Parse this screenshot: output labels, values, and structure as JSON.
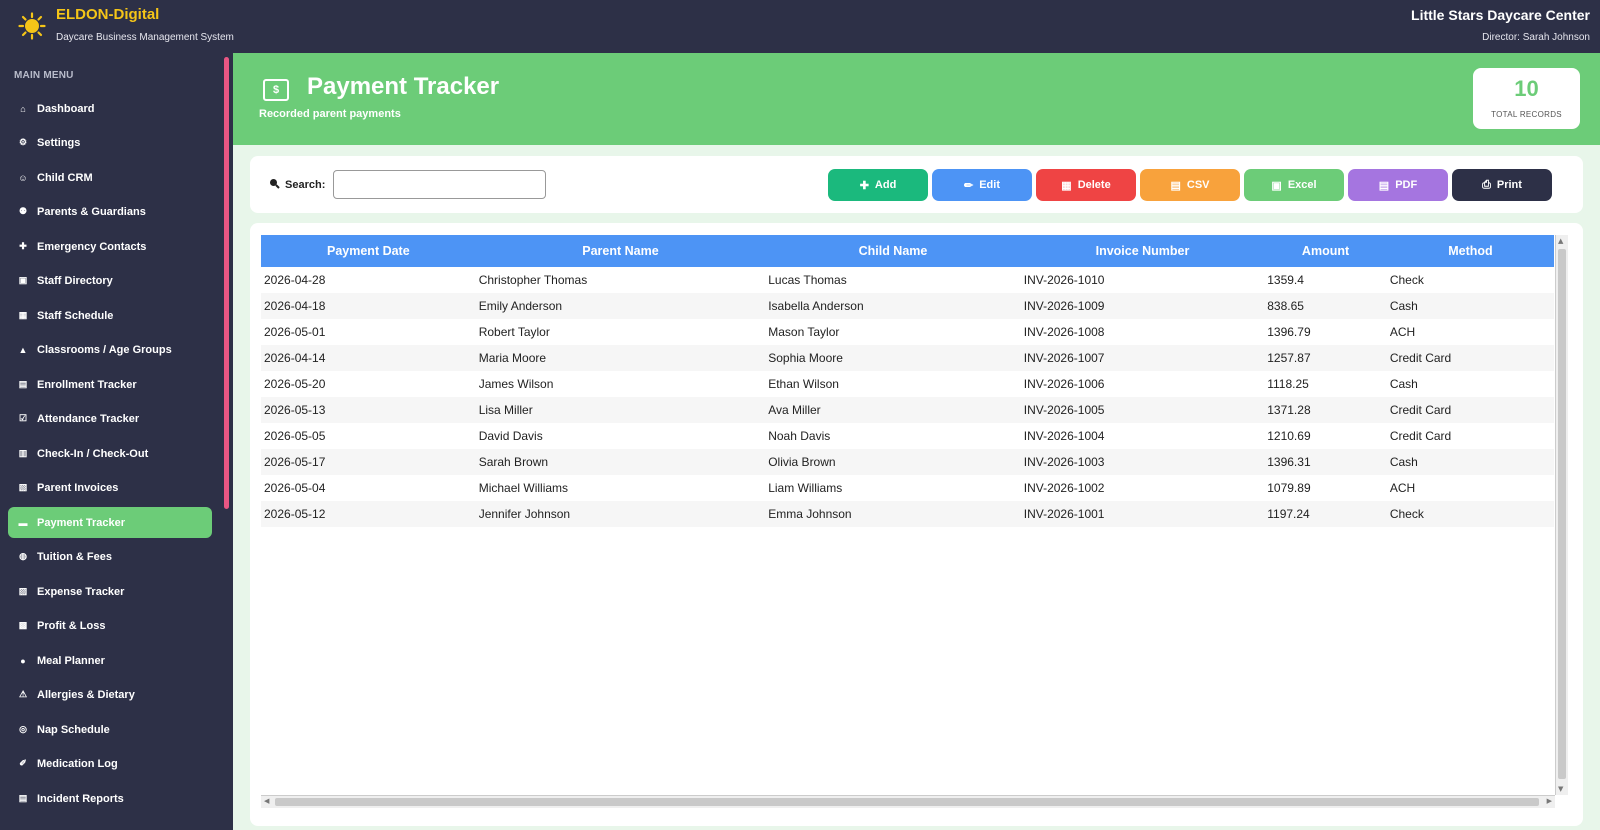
{
  "header": {
    "brand_name": "ELDON-Digital",
    "brand_subtitle": "Daycare Business Management System",
    "center_name": "Little Stars Daycare Center",
    "director": "Director: Sarah Johnson",
    "brand_color": "#f5c518"
  },
  "sidebar": {
    "title": "MAIN MENU",
    "active_color": "#6ccc78",
    "items": [
      {
        "label": "Dashboard",
        "icon": "home-icon",
        "glyph": "⌂"
      },
      {
        "label": "Settings",
        "icon": "gear-icon",
        "glyph": "⚙"
      },
      {
        "label": "Child CRM",
        "icon": "child-icon",
        "glyph": "☺"
      },
      {
        "label": "Parents & Guardians",
        "icon": "family-icon",
        "glyph": "⚉"
      },
      {
        "label": "Emergency Contacts",
        "icon": "emergency-icon",
        "glyph": "✚"
      },
      {
        "label": "Staff Directory",
        "icon": "staff-icon",
        "glyph": "▣"
      },
      {
        "label": "Staff Schedule",
        "icon": "calendar-icon",
        "glyph": "▦"
      },
      {
        "label": "Classrooms / Age Groups",
        "icon": "classroom-icon",
        "glyph": "▲"
      },
      {
        "label": "Enrollment Tracker",
        "icon": "enrollment-icon",
        "glyph": "▤"
      },
      {
        "label": "Attendance Tracker",
        "icon": "checkbox-icon",
        "glyph": "☑"
      },
      {
        "label": "Check-In / Check-Out",
        "icon": "checkin-icon",
        "glyph": "▥"
      },
      {
        "label": "Parent Invoices",
        "icon": "invoice-icon",
        "glyph": "▧"
      },
      {
        "label": "Payment Tracker",
        "icon": "payment-icon",
        "glyph": "▬",
        "active": true
      },
      {
        "label": "Tuition & Fees",
        "icon": "money-bag-icon",
        "glyph": "◍"
      },
      {
        "label": "Expense Tracker",
        "icon": "receipt-icon",
        "glyph": "▨"
      },
      {
        "label": "Profit & Loss",
        "icon": "chart-icon",
        "glyph": "▩"
      },
      {
        "label": "Meal Planner",
        "icon": "meal-icon",
        "glyph": "●"
      },
      {
        "label": "Allergies & Dietary",
        "icon": "warning-icon",
        "glyph": "⚠"
      },
      {
        "label": "Nap Schedule",
        "icon": "nap-icon",
        "glyph": "◎"
      },
      {
        "label": "Medication Log",
        "icon": "pill-icon",
        "glyph": "✐"
      },
      {
        "label": "Incident Reports",
        "icon": "report-icon",
        "glyph": "▤"
      }
    ]
  },
  "page": {
    "title": "Payment Tracker",
    "subtitle": "Recorded parent payments",
    "icon_text": "$",
    "accent": "#6ccc78",
    "total_records": "10",
    "total_records_label": "TOTAL RECORDS"
  },
  "toolbar": {
    "search_label": "Search:",
    "search_value": "",
    "buttons": [
      {
        "label": "Add",
        "icon": "plus-icon",
        "glyph": "✚",
        "color": "#1bb97d"
      },
      {
        "label": "Edit",
        "icon": "pencil-icon",
        "glyph": "✏",
        "color": "#4d94f5"
      },
      {
        "label": "Delete",
        "icon": "trash-icon",
        "glyph": "▦",
        "color": "#ef4444"
      },
      {
        "label": "CSV",
        "icon": "csv-file-icon",
        "glyph": "▤",
        "color": "#f8a23c"
      },
      {
        "label": "Excel",
        "icon": "excel-icon",
        "glyph": "▣",
        "color": "#6ccc78"
      },
      {
        "label": "PDF",
        "icon": "pdf-icon",
        "glyph": "▤",
        "color": "#a575e0"
      },
      {
        "label": "Print",
        "icon": "printer-icon",
        "glyph": "⎙",
        "color": "#2d3047"
      }
    ]
  },
  "table": {
    "header_color": "#4d94f5",
    "columns": [
      "Payment Date",
      "Parent Name",
      "Child Name",
      "Invoice Number",
      "Amount",
      "Method"
    ],
    "rows": [
      [
        "2026-04-28",
        "Christopher Thomas",
        "Lucas Thomas",
        "INV-2026-1010",
        "1359.4",
        "Check"
      ],
      [
        "2026-04-18",
        "Emily Anderson",
        "Isabella Anderson",
        "INV-2026-1009",
        "838.65",
        "Cash"
      ],
      [
        "2026-05-01",
        "Robert Taylor",
        "Mason Taylor",
        "INV-2026-1008",
        "1396.79",
        "ACH"
      ],
      [
        "2026-04-14",
        "Maria Moore",
        "Sophia Moore",
        "INV-2026-1007",
        "1257.87",
        "Credit Card"
      ],
      [
        "2026-05-20",
        "James Wilson",
        "Ethan Wilson",
        "INV-2026-1006",
        "1118.25",
        "Cash"
      ],
      [
        "2026-05-13",
        "Lisa Miller",
        "Ava Miller",
        "INV-2026-1005",
        "1371.28",
        "Credit Card"
      ],
      [
        "2026-05-05",
        "David Davis",
        "Noah Davis",
        "INV-2026-1004",
        "1210.69",
        "Credit Card"
      ],
      [
        "2026-05-17",
        "Sarah Brown",
        "Olivia Brown",
        "INV-2026-1003",
        "1396.31",
        "Cash"
      ],
      [
        "2026-05-04",
        "Michael Williams",
        "Liam Williams",
        "INV-2026-1002",
        "1079.89",
        "ACH"
      ],
      [
        "2026-05-12",
        "Jennifer Johnson",
        "Emma Johnson",
        "INV-2026-1001",
        "1197.24",
        "Check"
      ]
    ]
  }
}
